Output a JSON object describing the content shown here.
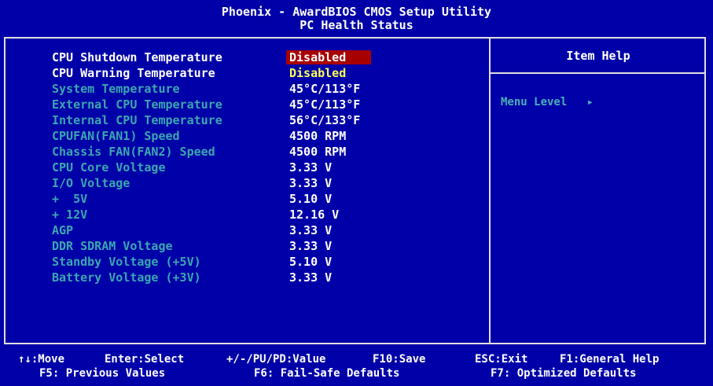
{
  "header": {
    "title": "Phoenix - AwardBIOS CMOS Setup Utility",
    "subtitle": "PC Health Status"
  },
  "help": {
    "title": "Item Help",
    "menu_level_label": "Menu Level",
    "menu_level_arrow": "▸"
  },
  "items": [
    {
      "label": "CPU Shutdown Temperature",
      "value": "Disabled"
    },
    {
      "label": "CPU Warning Temperature",
      "value": "Disabled"
    },
    {
      "label": "System Temperature",
      "value": "45°C/113°F"
    },
    {
      "label": "External CPU Temperature",
      "value": "45°C/113°F"
    },
    {
      "label": "Internal CPU Temperature",
      "value": "56°C/133°F"
    },
    {
      "label": "CPUFAN(FAN1) Speed",
      "value": "4500 RPM"
    },
    {
      "label": "Chassis FAN(FAN2) Speed",
      "value": "4500 RPM"
    },
    {
      "label": "CPU Core Voltage",
      "value": "3.33 V"
    },
    {
      "label": "I/O Voltage",
      "value": "3.33 V"
    },
    {
      "label": "+  5V",
      "value": "5.10 V"
    },
    {
      "label": "+ 12V",
      "value": "12.16 V"
    },
    {
      "label": "AGP",
      "value": "3.33 V"
    },
    {
      "label": "DDR SDRAM Voltage",
      "value": "3.33 V"
    },
    {
      "label": "Standby Voltage (+5V)",
      "value": "5.10 V"
    },
    {
      "label": "Battery Voltage (+3V)",
      "value": "3.33 V"
    }
  ],
  "footer": {
    "move": "↑↓:Move",
    "enter": "Enter:Select",
    "value": "+/-/PU/PD:Value",
    "save": "F10:Save",
    "exit": "ESC:Exit",
    "general_help": "F1:General Help",
    "previous": "F5: Previous Values",
    "failsafe": "F6: Fail-Safe Defaults",
    "optimized": "F7: Optimized Defaults"
  },
  "colors": {
    "background": "#0000a8",
    "selected": "#a80000",
    "inactive_text": "#3aa8b0",
    "highlight_value": "#ffff55"
  }
}
